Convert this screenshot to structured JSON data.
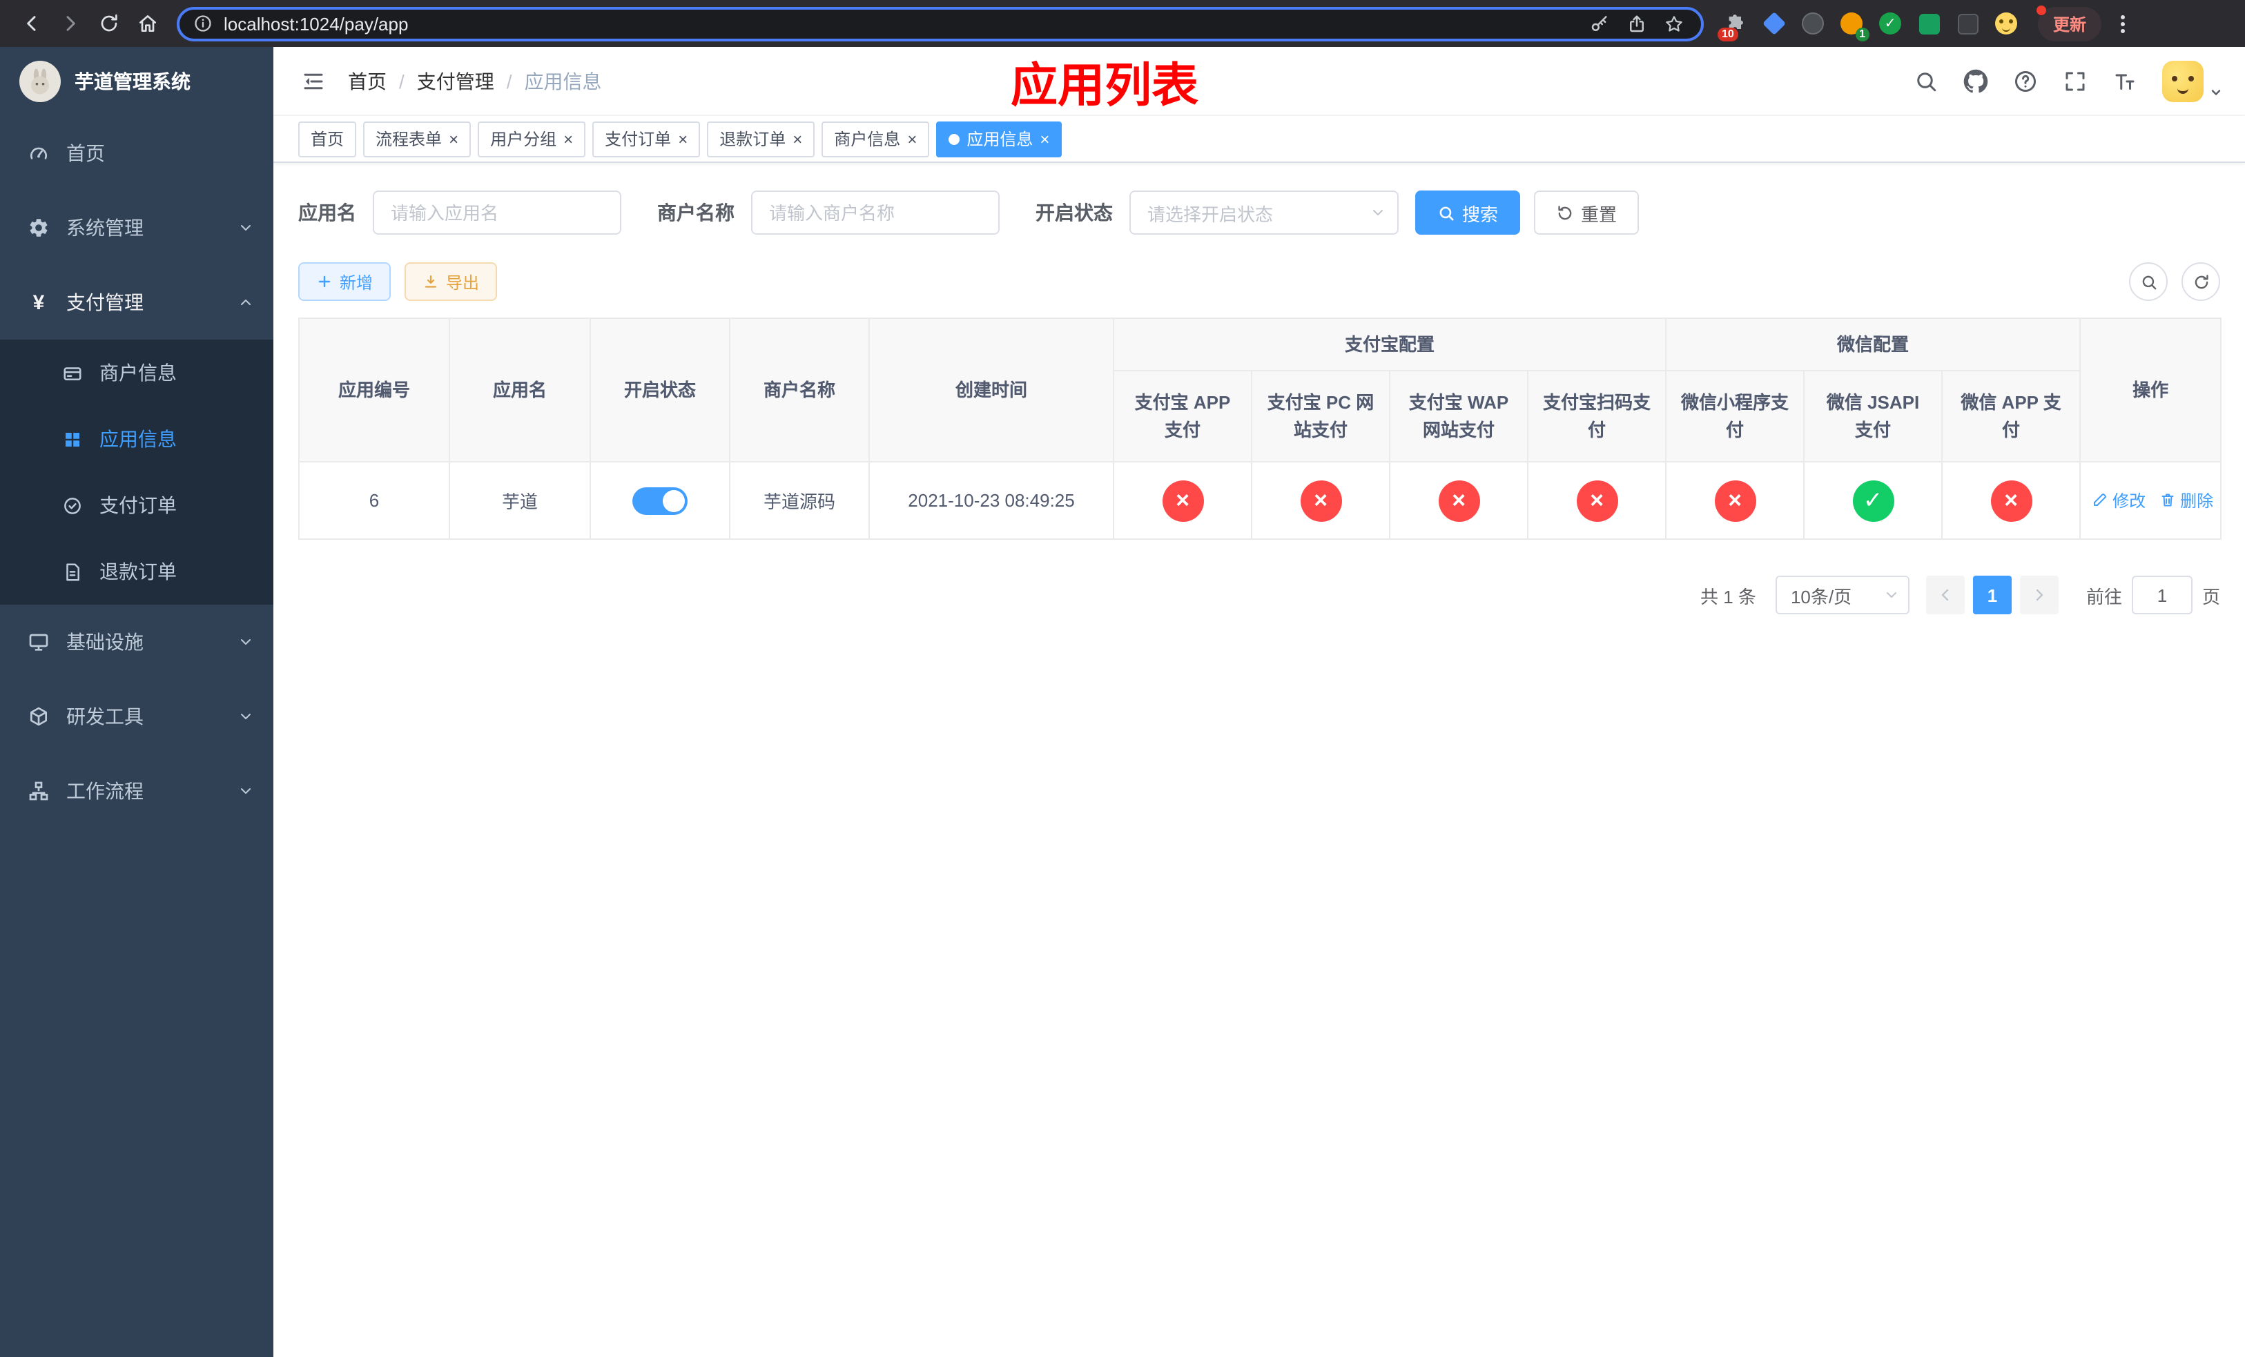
{
  "colors": {
    "primary": "#409EFF",
    "success": "#13ce66",
    "danger": "#ff4949",
    "annotation": "#ff0000",
    "sidebar_bg": "#304156"
  },
  "browser": {
    "url": "localhost:1024/pay/app",
    "extensions_badge": "10",
    "whatsapp_badge": "1",
    "update_button": "更新"
  },
  "sidebar": {
    "title": "芋道管理系统",
    "menu": [
      {
        "label": "首页"
      },
      {
        "label": "系统管理"
      },
      {
        "label": "支付管理"
      },
      {
        "label": "基础设施"
      },
      {
        "label": "研发工具"
      },
      {
        "label": "工作流程"
      }
    ],
    "submenu": [
      {
        "label": "商户信息"
      },
      {
        "label": "应用信息"
      },
      {
        "label": "支付订单"
      },
      {
        "label": "退款订单"
      }
    ]
  },
  "header": {
    "breadcrumb": [
      "首页",
      "支付管理",
      "应用信息"
    ],
    "annotation": "应用列表"
  },
  "tabs": [
    {
      "label": "首页"
    },
    {
      "label": "流程表单"
    },
    {
      "label": "用户分组"
    },
    {
      "label": "支付订单"
    },
    {
      "label": "退款订单"
    },
    {
      "label": "商户信息"
    },
    {
      "label": "应用信息"
    }
  ],
  "filters": {
    "app_name_label": "应用名",
    "app_name_placeholder": "请输入应用名",
    "merchant_label": "商户名称",
    "merchant_placeholder": "请输入商户名称",
    "status_label": "开启状态",
    "status_placeholder": "请选择开启状态",
    "search_button": "搜索",
    "reset_button": "重置"
  },
  "toolbar": {
    "add_button": "新增",
    "export_button": "导出"
  },
  "table": {
    "group_headers": {
      "alipay": "支付宝配置",
      "wechat": "微信配置"
    },
    "columns": {
      "app_id": "应用编号",
      "app_name": "应用名",
      "status": "开启状态",
      "merchant": "商户名称",
      "created": "创建时间",
      "alipay_app": "支付宝 APP 支付",
      "alipay_pc": "支付宝 PC 网站支付",
      "alipay_wap": "支付宝 WAP 网站支付",
      "alipay_qr": "支付宝扫码支付",
      "wechat_mini": "微信小程序支付",
      "wechat_jsapi": "微信 JSAPI 支付",
      "wechat_app": "微信 APP 支付",
      "actions": "操作"
    },
    "rows": [
      {
        "app_id": "6",
        "app_name": "芋道",
        "enabled": true,
        "merchant": "芋道源码",
        "created": "2021-10-23 08:49:25",
        "alipay_app": false,
        "alipay_pc": false,
        "alipay_wap": false,
        "alipay_qr": false,
        "wechat_mini": false,
        "wechat_jsapi": true,
        "wechat_app": false,
        "edit_label": "修改",
        "delete_label": "删除"
      }
    ]
  },
  "pagination": {
    "total": "共 1 条",
    "page_size": "10条/页",
    "current_page": "1",
    "goto_label": "前往",
    "goto_value": "1",
    "page_suffix": "页"
  }
}
